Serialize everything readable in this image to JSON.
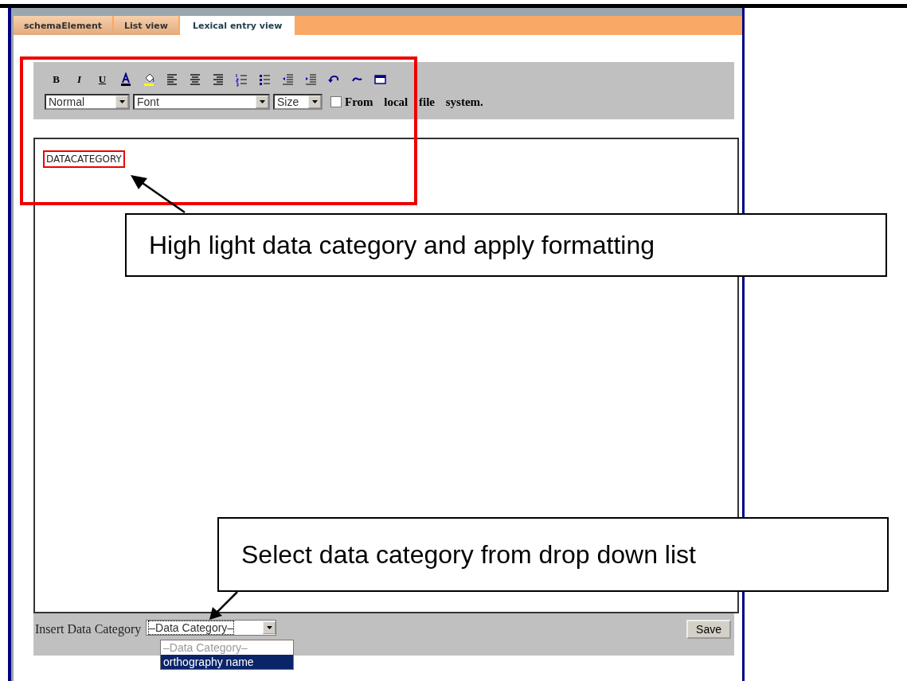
{
  "tabs": [
    {
      "label": "schemaElement",
      "selected": false
    },
    {
      "label": "List view",
      "selected": false
    },
    {
      "label": "Lexical entry view",
      "selected": true
    }
  ],
  "toolbar": {
    "format_buttons": [
      "B",
      "I",
      "U"
    ],
    "selects": [
      {
        "value": "Normal"
      },
      {
        "value": "Font"
      },
      {
        "value": "Size"
      }
    ],
    "checkbox": {
      "label": "From local file system.",
      "checked": false
    }
  },
  "editor": {
    "content": "DATACATEGORY",
    "highlighted": true
  },
  "bottom_bar": {
    "label": "Insert Data Category",
    "select": {
      "value": "–Data Category–",
      "expanded": true
    },
    "options": [
      {
        "label": "–Data Category–",
        "selected": false
      },
      {
        "label": "orthography name",
        "selected": true
      }
    ],
    "save_button": "Save"
  },
  "callouts": [
    {
      "text": "High light data category and apply formatting"
    },
    {
      "text": "Select data category from drop down list"
    }
  ]
}
